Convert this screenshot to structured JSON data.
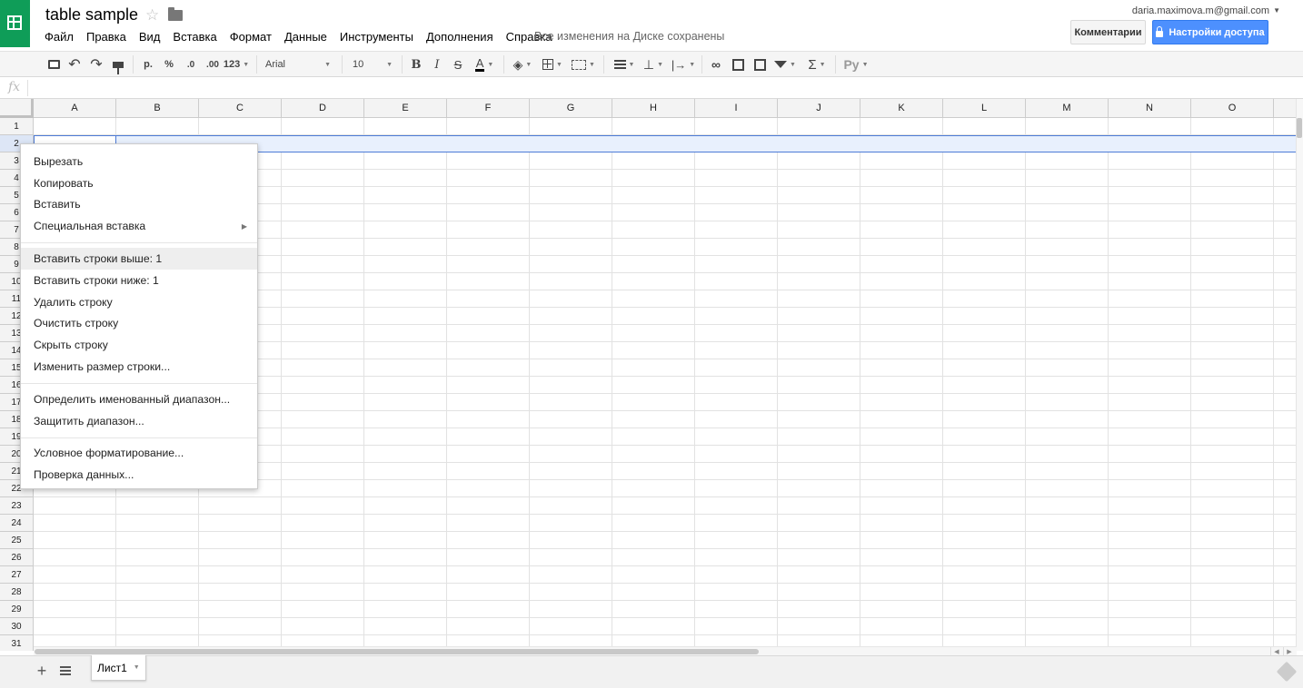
{
  "document": {
    "title": "table sample",
    "save_status": "Все изменения на Диске сохранены"
  },
  "menu": [
    "Файл",
    "Правка",
    "Вид",
    "Вставка",
    "Формат",
    "Данные",
    "Инструменты",
    "Дополнения",
    "Справка"
  ],
  "account": {
    "email": "daria.maximova.m@gmail.com",
    "comments_label": "Комментарии",
    "share_label": "Настройки доступа"
  },
  "toolbar": {
    "currency": "р.",
    "percent": "%",
    "decrease_decimals": ".0",
    "increase_decimals": ".00",
    "more_formats": "123",
    "font_family": "Arial",
    "font_size": "10",
    "bold": "B",
    "italic": "I",
    "strikethrough": "S",
    "text_color": "A",
    "functions": "Σ",
    "input_tools": "Ру"
  },
  "formula_bar": {
    "fx_label": "fx",
    "value": ""
  },
  "grid": {
    "columns": [
      "A",
      "B",
      "C",
      "D",
      "E",
      "F",
      "G",
      "H",
      "I",
      "J",
      "K",
      "L",
      "M",
      "N",
      "O"
    ],
    "rows": [
      "1",
      "2",
      "3",
      "4",
      "5",
      "6",
      "7",
      "8",
      "9",
      "10",
      "11",
      "12",
      "13",
      "14",
      "15",
      "16",
      "17",
      "18",
      "19",
      "20",
      "21",
      "22",
      "23",
      "24",
      "25",
      "26",
      "27",
      "28",
      "29",
      "30",
      "31"
    ],
    "selected_row": "2"
  },
  "context_menu": {
    "groups": [
      [
        {
          "label": "Вырезать"
        },
        {
          "label": "Копировать"
        },
        {
          "label": "Вставить"
        },
        {
          "label": "Специальная вставка",
          "submenu": true
        }
      ],
      [
        {
          "label": "Вставить строки выше: 1",
          "hover": true
        },
        {
          "label": "Вставить строки ниже: 1"
        },
        {
          "label": "Удалить строку"
        },
        {
          "label": "Очистить строку"
        },
        {
          "label": "Скрыть строку"
        },
        {
          "label": "Изменить размер строки..."
        }
      ],
      [
        {
          "label": "Определить именованный диапазон..."
        },
        {
          "label": "Защитить диапазон..."
        }
      ],
      [
        {
          "label": "Условное форматирование..."
        },
        {
          "label": "Проверка данных..."
        }
      ]
    ]
  },
  "sheets": {
    "active_tab": "Лист1",
    "add_sheet_label": "+"
  },
  "colors": {
    "brand_green": "#0f9d58",
    "share_blue": "#4d90fe",
    "selection_blue": "#4d7bd6",
    "selection_fill": "#e8f0fd"
  }
}
